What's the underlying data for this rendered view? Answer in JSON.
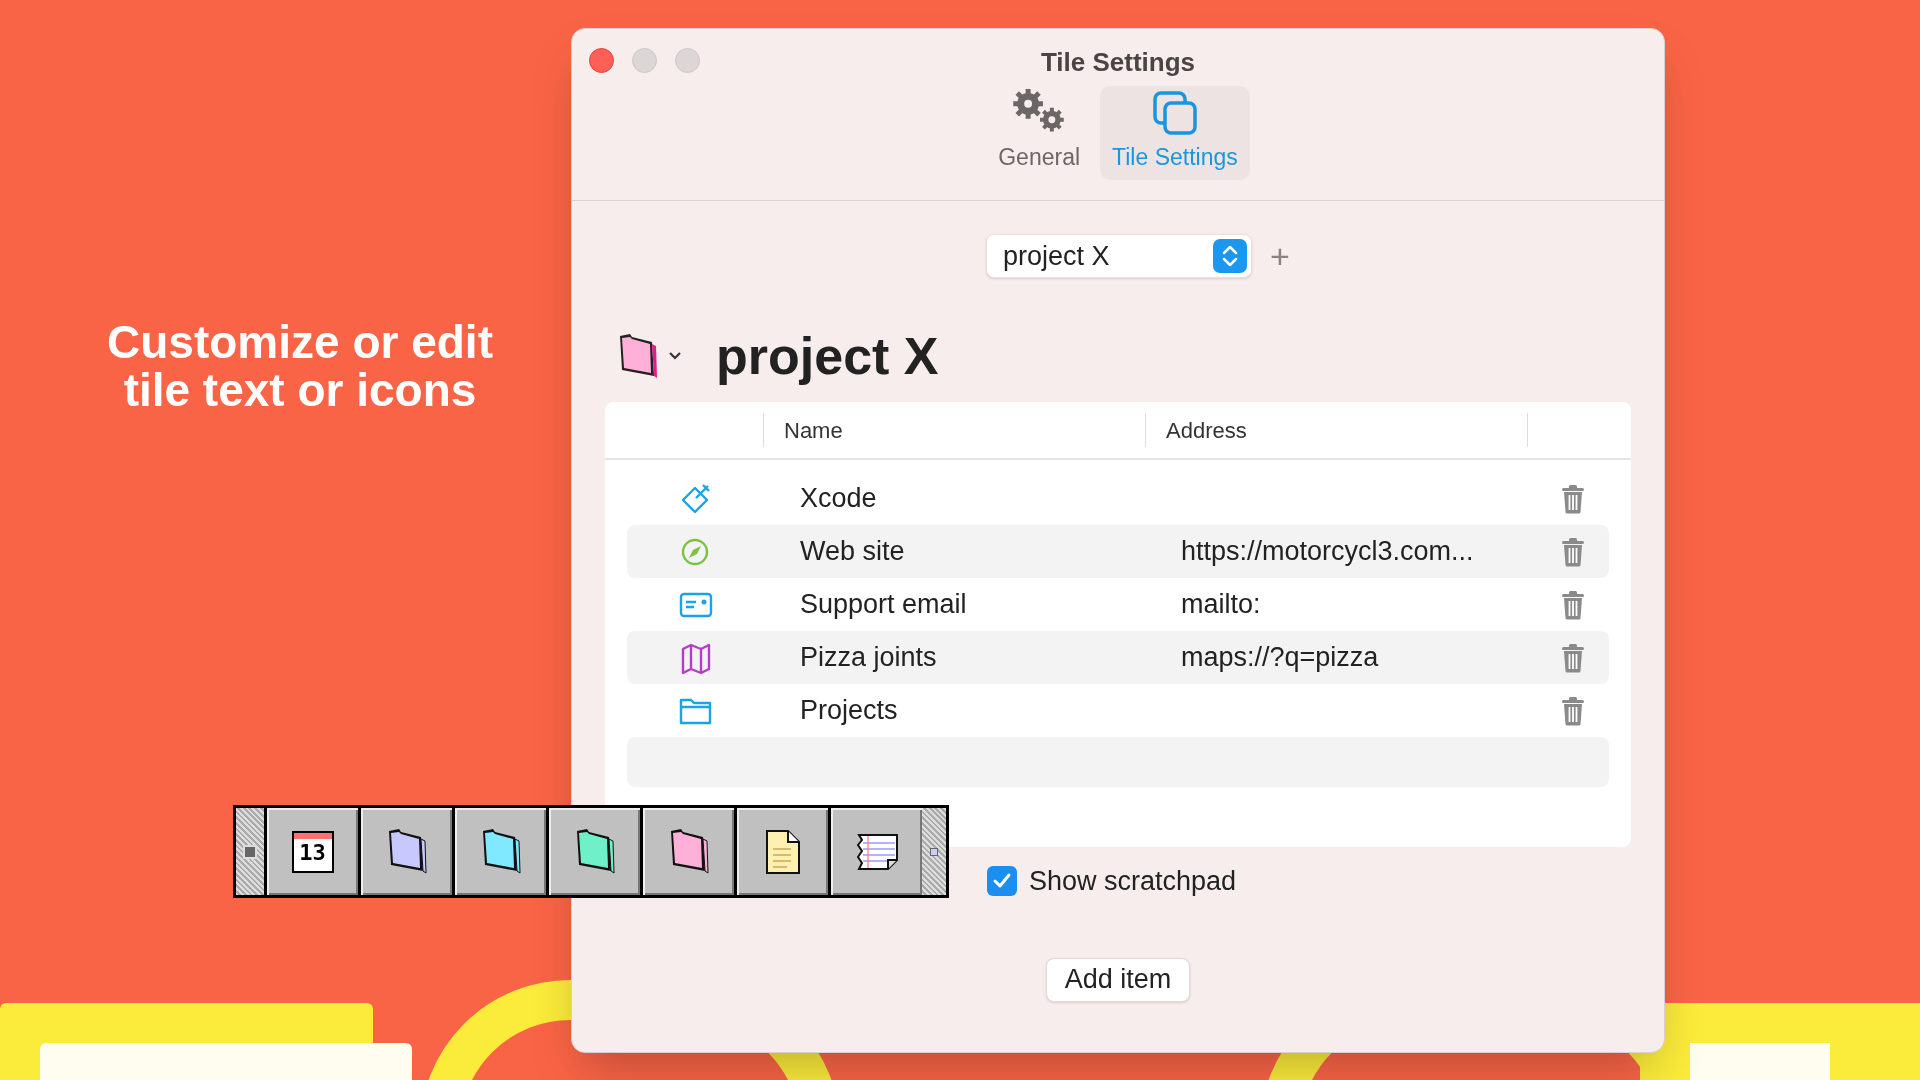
{
  "promo_text": "Customize or edit tile text or icons",
  "window": {
    "title": "Tile Settings"
  },
  "tabs": [
    {
      "label": "General",
      "kind": "gears",
      "selected": false
    },
    {
      "label": "Tile Settings",
      "kind": "tiles",
      "selected": true
    }
  ],
  "set_picker": {
    "value": "project X",
    "add_label": "+"
  },
  "heading": {
    "title": "project X"
  },
  "table": {
    "columns": [
      "Name",
      "Address"
    ],
    "rows": [
      {
        "kind": "app",
        "color": "#1aa3e8",
        "name": "Xcode"
      },
      {
        "kind": "web",
        "color": "#7cc242",
        "name": "Web site",
        "address": "https://motorcycl3.com..."
      },
      {
        "kind": "email",
        "color": "#1aa3e8",
        "name": "Support email",
        "address": "mailto:"
      },
      {
        "kind": "map",
        "color": "#b33fc9",
        "name": "Pizza joints",
        "address": "maps://?q=pizza"
      },
      {
        "kind": "folder",
        "color": "#1aa3e8",
        "name": "Projects"
      }
    ]
  },
  "show_scratchpad": {
    "label": "Show scratchpad",
    "checked": true
  },
  "add_button": "Add item",
  "tile_bar": [
    {
      "kind": "calendar",
      "text": "13"
    },
    {
      "kind": "folder",
      "color": "#c8c8ff"
    },
    {
      "kind": "folder",
      "color": "#80e8ff"
    },
    {
      "kind": "folder",
      "color": "#70f0c8"
    },
    {
      "kind": "folder",
      "color": "#ffb0d8"
    },
    {
      "kind": "document"
    },
    {
      "kind": "note"
    }
  ]
}
